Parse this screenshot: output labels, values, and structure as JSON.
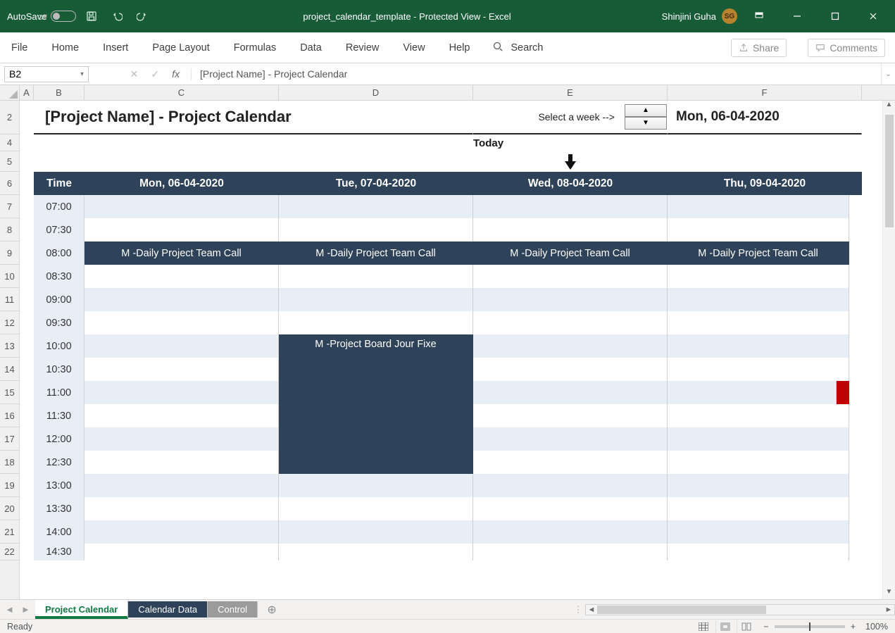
{
  "titlebar": {
    "autosave_label": "AutoSave",
    "autosave_state": "Off",
    "doc_title": "project_calendar_template  -  Protected View  -  Excel",
    "user_name": "Shinjini Guha",
    "user_initials": "SG"
  },
  "ribbon": {
    "tabs": [
      "File",
      "Home",
      "Insert",
      "Page Layout",
      "Formulas",
      "Data",
      "Review",
      "View",
      "Help"
    ],
    "search_label": "Search",
    "share_label": "Share",
    "comments_label": "Comments"
  },
  "fbar": {
    "namebox": "B2",
    "formula": "[Project Name] - Project Calendar"
  },
  "columns": [
    "A",
    "B",
    "C",
    "D",
    "E",
    "F"
  ],
  "rows": [
    "2",
    "4",
    "5",
    "6",
    "7",
    "8",
    "9",
    "10",
    "11",
    "12",
    "13",
    "14",
    "15",
    "16",
    "17",
    "18",
    "19",
    "20",
    "21",
    "22"
  ],
  "calendar": {
    "title": "[Project Name] - Project Calendar",
    "select_week_label": "Select a week -->",
    "week_date": "Mon, 06-04-2020",
    "today_label": "Today",
    "time_header": "Time",
    "day_headers": [
      "Mon, 06-04-2020",
      "Tue, 07-04-2020",
      "Wed, 08-04-2020",
      "Thu, 09-04-2020"
    ],
    "times": [
      "07:00",
      "07:30",
      "08:00",
      "08:30",
      "09:00",
      "09:30",
      "10:00",
      "10:30",
      "11:00",
      "11:30",
      "12:00",
      "12:30",
      "13:00",
      "13:30",
      "14:00",
      "14:30"
    ],
    "events": {
      "row_0800": "M -Daily Project Team Call",
      "board_event": "M -Project Board Jour Fixe"
    }
  },
  "sheets": {
    "tabs": [
      "Project Calendar",
      "Calendar Data",
      "Control"
    ]
  },
  "status": {
    "ready": "Ready",
    "zoom": "100%"
  }
}
